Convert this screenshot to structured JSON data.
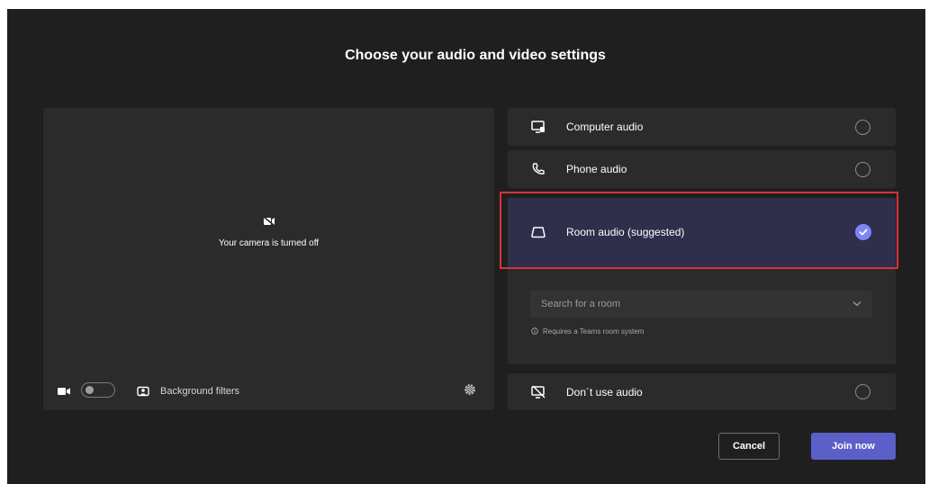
{
  "dialog": {
    "title": "Choose your audio and video settings"
  },
  "preview": {
    "camera_message": "Your camera is turned off",
    "background_filters_label": "Background filters",
    "camera_toggle_on": false
  },
  "audio_options": {
    "computer": {
      "label": "Computer audio",
      "selected": false
    },
    "phone": {
      "label": "Phone audio",
      "selected": false
    },
    "room": {
      "label": "Room audio (suggested)",
      "selected": true
    },
    "none": {
      "label": "Don´t use audio",
      "selected": false
    }
  },
  "room_search": {
    "placeholder": "Search for a room",
    "requirement_note": "Requires a Teams room system"
  },
  "buttons": {
    "cancel": "Cancel",
    "join": "Join now"
  },
  "colors": {
    "background": "#1f1f1f",
    "panel": "#2b2b2b",
    "selected_option": "#2f2e4b",
    "accent": "#5b5fc7",
    "check": "#7f85f5",
    "highlight_outline": "#d13438"
  },
  "icons": {
    "computer": "computer-audio-icon",
    "phone": "phone-icon",
    "room": "room-audio-icon",
    "none": "no-audio-icon",
    "camera_off": "camera-off-icon",
    "camera": "camera-icon",
    "background": "background-filters-icon",
    "settings": "gear-icon",
    "dropdown": "chevron-down-icon",
    "info": "info-icon"
  }
}
